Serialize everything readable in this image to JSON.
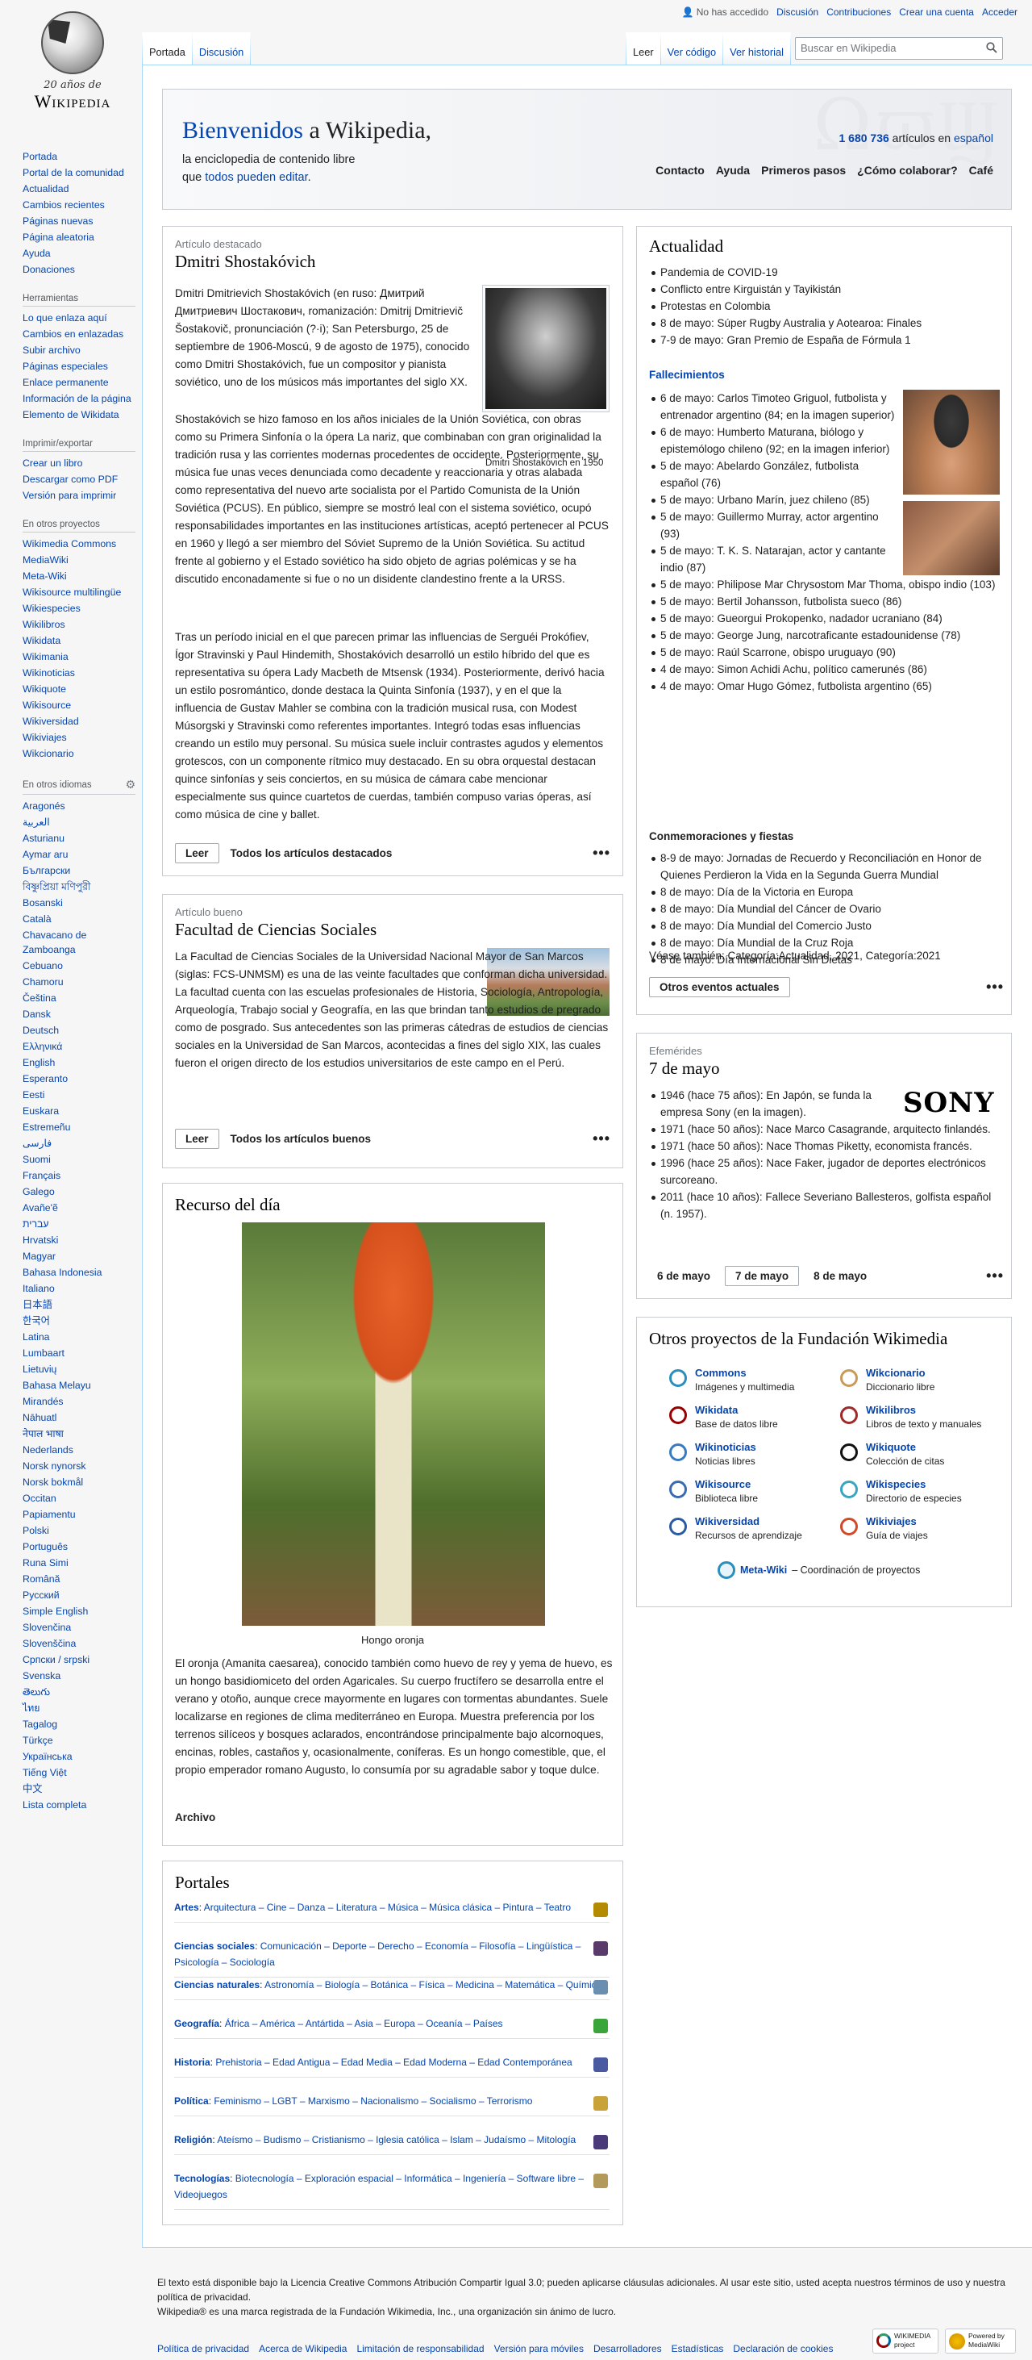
{
  "logo": {
    "twenty": "20 años de",
    "wordmark": "Wikipedia"
  },
  "personal": {
    "anon": "No has accedido",
    "links": [
      "Discusión",
      "Contribuciones",
      "Crear una cuenta",
      "Acceder"
    ]
  },
  "tabs": {
    "left": [
      "Portada",
      "Discusión"
    ],
    "right": [
      "Leer",
      "Ver código",
      "Ver historial"
    ]
  },
  "search": {
    "placeholder": "Buscar en Wikipedia"
  },
  "nav": {
    "main": [
      "Portada",
      "Portal de la comunidad",
      "Actualidad",
      "Cambios recientes",
      "Páginas nuevas",
      "Página aleatoria",
      "Ayuda",
      "Donaciones"
    ],
    "tools_title": "Herramientas",
    "tools": [
      "Lo que enlaza aquí",
      "Cambios en enlazadas",
      "Subir archivo",
      "Páginas especiales",
      "Enlace permanente",
      "Información de la página",
      "Elemento de Wikidata"
    ],
    "print_title": "Imprimir/exportar",
    "print": [
      "Crear un libro",
      "Descargar como PDF",
      "Versión para imprimir"
    ],
    "projects_title": "En otros proyectos",
    "projects": [
      "Wikimedia Commons",
      "MediaWiki",
      "Meta-Wiki",
      "Wikisource multilingüe",
      "Wikiespecies",
      "Wikilibros",
      "Wikidata",
      "Wikimania",
      "Wikinoticias",
      "Wikiquote",
      "Wikisource",
      "Wikiversidad",
      "Wikiviajes",
      "Wikcionario"
    ],
    "lang_title": "En otros idiomas",
    "languages": [
      "Aragonés",
      "العربية",
      "Asturianu",
      "Aymar aru",
      "Български",
      "বিষ্ণুপ্রিয়া মণিপুরী",
      "Bosanski",
      "Català",
      "Chavacano de Zamboanga",
      "Cebuano",
      "Chamoru",
      "Čeština",
      "Dansk",
      "Deutsch",
      "Ελληνικά",
      "English",
      "Esperanto",
      "Eesti",
      "Euskara",
      "Estremeñu",
      "فارسی",
      "Suomi",
      "Français",
      "Galego",
      "Avañe'ẽ",
      "עברית",
      "Hrvatski",
      "Magyar",
      "Bahasa Indonesia",
      "Italiano",
      "日本語",
      "한국어",
      "Latina",
      "Lumbaart",
      "Lietuvių",
      "Bahasa Melayu",
      "Mirandés",
      "Nāhuatl",
      "नेपाल भाषा",
      "Nederlands",
      "Norsk nynorsk",
      "Norsk bokmål",
      "Occitan",
      "Papiamentu",
      "Polski",
      "Português",
      "Runa Simi",
      "Română",
      "Русский",
      "Simple English",
      "Slovenčina",
      "Slovenščina",
      "Српски / srpski",
      "Svenska",
      "తెలుగు",
      "ไทย",
      "Tagalog",
      "Türkçe",
      "Українська",
      "Tiếng Việt",
      "中文",
      "Lista completa"
    ]
  },
  "banner": {
    "title_link": "Bienvenidos",
    "title_rest": " a Wikipedia,",
    "sub1": "la enciclopedia de contenido libre",
    "sub2a": "que ",
    "sub2b": "todos pueden editar",
    "sub2c": ".",
    "count": "1 680 736",
    "count_rest": " artículos en ",
    "count_lang": "español",
    "bg": "ΩϖϢ",
    "links": [
      "Contacto",
      "Ayuda",
      "Primeros pasos",
      "¿Cómo colaborar?",
      "Café"
    ]
  },
  "featured": {
    "kicker": "Artículo destacado",
    "title": "Dmitri Shostakóvich",
    "caption": "Dmitri Shostakóvich en 1950",
    "p1": "Dmitri Dmitrievich Shostakóvich (en ruso: Дмитрий Дмитриевич Шостакович, romanización: Dmitrij Dmitrievič Šostakovič, pronunciación (?·i); San Petersburgo, 25 de septiembre de 1906-Moscú, 9 de agosto de 1975), conocido como Dmitri Shostakóvich, fue un compositor y pianista soviético, uno de los músicos más importantes del siglo XX.",
    "p2": "Shostakóvich se hizo famoso en los años iniciales de la Unión Soviética, con obras como su Primera Sinfonía o la ópera La nariz, que combinaban con gran originalidad la tradición rusa y las corrientes modernas procedentes de occidente. Posteriormente, su música fue unas veces denunciada como decadente y reaccionaria y otras alabada como representativa del nuevo arte socialista por el Partido Comunista de la Unión Soviética (PCUS). En público, siempre se mostró leal con el sistema soviético, ocupó responsabilidades importantes en las instituciones artísticas, aceptó pertenecer al PCUS en 1960 y llegó a ser miembro del Sóviet Supremo de la Unión Soviética. Su actitud frente al gobierno y el Estado soviético ha sido objeto de agrias polémicas y se ha discutido enconadamente si fue o no un disidente clandestino frente a la URSS.",
    "p3": "Tras un período inicial en el que parecen primar las influencias de Serguéi Prokófiev, Ígor Stravinski y Paul Hindemith, Shostakóvich desarrolló un estilo híbrido del que es representativa su ópera Lady Macbeth de Mtsensk (1934). Posteriormente, derivó hacia un estilo posromántico, donde destaca la Quinta Sinfonía (1937), y en el que la influencia de Gustav Mahler se combina con la tradición musical rusa, con Modest Músorgski y Stravinski como referentes importantes. Integró todas esas influencias creando un estilo muy personal. Su música suele incluir contrastes agudos y elementos grotescos, con un componente rítmico muy destacado. En su obra orquestal destacan quince sinfonías y seis conciertos, en su música de cámara cabe mencionar especialmente sus quince cuartetos de cuerdas, también compuso varias óperas, así como música de cine y ballet.",
    "read": "Leer",
    "all": "Todos los artículos destacados"
  },
  "good": {
    "kicker": "Artículo bueno",
    "title": "Facultad de Ciencias Sociales",
    "p1": "La Facultad de Ciencias Sociales de la Universidad Nacional Mayor de San Marcos (siglas: FCS-UNMSM) es una de las veinte facultades que conforman dicha universidad. La facultad cuenta con las escuelas profesionales de Historia, Sociología, Antropología, Arqueología, Trabajo social y Geografía, en las que brindan tanto estudios de pregrado como de posgrado. Sus antecedentes son las primeras cátedras de estudios de ciencias sociales en la Universidad de San Marcos, acontecidas a fines del siglo XIX, las cuales fueron el origen directo de los estudios universitarios de este campo en el Perú.",
    "read": "Leer",
    "all": "Todos los artículos buenos"
  },
  "resource": {
    "title": "Recurso del día",
    "caption": "Hongo oronja",
    "p1": "El oronja (Amanita caesarea), conocido también como huevo de rey y yema de huevo, es un hongo basidiomiceto del orden Agaricales. Su cuerpo fructífero se desarrolla entre el verano y otoño, aunque crece mayormente en lugares con tormentas abundantes. Suele localizarse en regiones de clima mediterráneo en Europa. Muestra preferencia por los terrenos silíceos y bosques aclarados, encontrándose principalmente bajo alcornoques, encinas, robles, castaños y, ocasionalmente, coníferas. Es un hongo comestible, que, el propio emperador romano Augusto, lo consumía por su agradable sabor y toque dulce.",
    "archive": "Archivo"
  },
  "portals": {
    "title": "Portales",
    "rows": [
      {
        "name": "Artes",
        "items": "Arquitectura – Cine – Danza – Literatura – Música – Música clásica – Pintura – Teatro"
      },
      {
        "name": "Ciencias sociales",
        "items": "Comunicación – Deporte – Derecho – Economía – Filosofía – Lingüística – Psicología – Sociología"
      },
      {
        "name": "Ciencias naturales",
        "items": "Astronomía – Biología – Botánica – Física – Medicina – Matemática – Química"
      },
      {
        "name": "Geografía",
        "items": "África – América – Antártida – Asia – Europa – Oceanía – Países"
      },
      {
        "name": "Historia",
        "items": "Prehistoria – Edad Antigua – Edad Media – Edad Moderna – Edad Contemporánea"
      },
      {
        "name": "Política",
        "items": "Feminismo – LGBT – Marxismo – Nacionalismo – Socialismo – Terrorismo"
      },
      {
        "name": "Religión",
        "items": "Ateísmo – Budismo – Cristianismo – Iglesia católica – Islam – Judaísmo – Mitología"
      },
      {
        "name": "Tecnologías",
        "items": "Biotecnología – Exploración espacial – Informática – Ingeniería – Software libre – Videojuegos"
      }
    ]
  },
  "news": {
    "title": "Actualidad",
    "items": [
      "Pandemia de COVID-19",
      "Conflicto entre Kirguistán y Tayikistán",
      "Protestas en Colombia",
      "8 de mayo: Súper Rugby Australia y Aotearoa: Finales",
      "7-9 de mayo: Gran Premio de España de Fórmula 1"
    ],
    "deaths_title": "Fallecimientos",
    "deaths": [
      "6 de mayo: Carlos Timoteo Griguol, futbolista y entrenador argentino (84; en la imagen superior)",
      "6 de mayo: Humberto Maturana, biólogo y epistemólogo chileno (92; en la imagen inferior)",
      "5 de mayo: Abelardo González, futbolista español (76)",
      "5 de mayo: Urbano Marín, juez chileno (85)",
      "5 de mayo: Guillermo Murray, actor argentino (93)",
      "5 de mayo: T. K. S. Natarajan, actor y cantante indio (87)",
      "5 de mayo: Philipose Mar Chrysostom Mar Thoma, obispo indio (103)",
      "5 de mayo: Bertil Johansson, futbolista sueco (86)",
      "5 de mayo: Gueorgui Prokopenko, nadador ucraniano (84)",
      "5 de mayo: George Jung, narcotraficante estadounidense (78)",
      "5 de mayo: Raúl Scarrone, obispo uruguayo (90)",
      "4 de mayo: Simon Achidi Achu, político camerunés (86)",
      "4 de mayo: Omar Hugo Gómez, futbolista argentino (65)"
    ],
    "comm_title": "Conmemoraciones y fiestas",
    "comm": [
      "8-9 de mayo: Jornadas de Recuerdo y Reconciliación en Honor de Quienes Perdieron la Vida en la Segunda Guerra Mundial",
      "8 de mayo: Día de la Victoria en Europa",
      "8 de mayo: Día Mundial del Cáncer de Ovario",
      "8 de mayo: Día Mundial del Comercio Justo",
      "8 de mayo: Día Mundial de la Cruz Roja",
      "8 de mayo: Día Internacional Sin Dietas"
    ],
    "see_also": "Véase también: Categoría:Actualidad, 2021, Categoría:2021",
    "more": "Otros eventos actuales"
  },
  "ephem": {
    "kicker": "Efemérides",
    "title": "7 de mayo",
    "sony": "SONY",
    "items": [
      "1946 (hace 75 años): En Japón, se funda la empresa Sony (en la imagen).",
      "1971 (hace 50 años): Nace Marco Casagrande, arquitecto finlandés.",
      "1971 (hace 50 años): Nace Thomas Piketty, economista francés.",
      "1996 (hace 25 años): Nace Faker, jugador de deportes electrónicos surcoreano.",
      "2011 (hace 10 años): Fallece Severiano Ballesteros, golfista español (n. 1957)."
    ],
    "days": [
      "6 de mayo",
      "7 de mayo",
      "8 de mayo"
    ]
  },
  "wm": {
    "title": "Otros proyectos de la Fundación Wikimedia",
    "projects": [
      {
        "name": "Commons",
        "desc": "Imágenes y multimedia"
      },
      {
        "name": "Wikcionario",
        "desc": "Diccionario libre"
      },
      {
        "name": "Wikidata",
        "desc": "Base de datos libre"
      },
      {
        "name": "Wikilibros",
        "desc": "Libros de texto y manuales"
      },
      {
        "name": "Wikinoticias",
        "desc": "Noticias libres"
      },
      {
        "name": "Wikiquote",
        "desc": "Colección de citas"
      },
      {
        "name": "Wikisource",
        "desc": "Biblioteca libre"
      },
      {
        "name": "Wikispecies",
        "desc": "Directorio de especies"
      },
      {
        "name": "Wikiversidad",
        "desc": "Recursos de aprendizaje"
      },
      {
        "name": "Wikiviajes",
        "desc": "Guía de viajes"
      }
    ],
    "meta_name": "Meta-Wiki",
    "meta_desc": " – Coordinación de proyectos"
  },
  "footer": {
    "line1": "El texto está disponible bajo la Licencia Creative Commons Atribución Compartir Igual 3.0; pueden aplicarse cláusulas adicionales. Al usar este sitio, usted acepta nuestros términos de uso y nuestra política de privacidad.",
    "line2": "Wikipedia® es una marca registrada de la Fundación Wikimedia, Inc., una organización sin ánimo de lucro.",
    "links": [
      "Política de privacidad",
      "Acerca de Wikipedia",
      "Limitación de responsabilidad",
      "Versión para móviles",
      "Desarrolladores",
      "Estadísticas",
      "Declaración de cookies"
    ],
    "badge1": "WIKIMEDIA project",
    "badge2": "Powered by MediaWiki"
  }
}
